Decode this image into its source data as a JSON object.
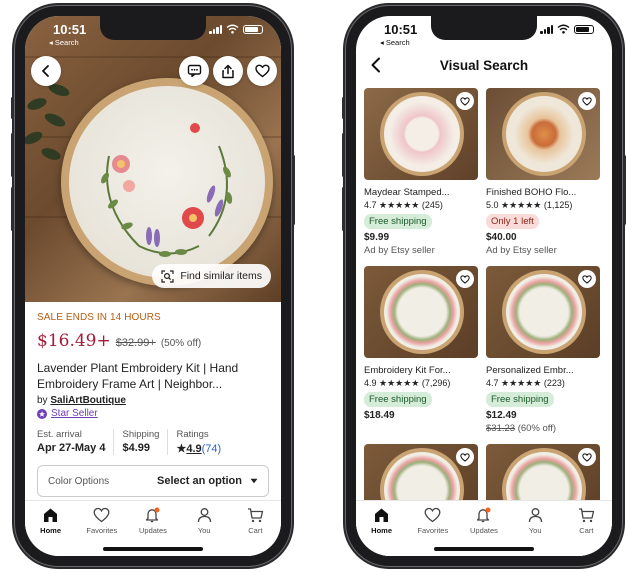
{
  "status": {
    "time": "10:51",
    "back_label": "◂ Search"
  },
  "listing": {
    "similar_label": "Find similar items",
    "sale_banner": "SALE ENDS IN 14 HOURS",
    "price_now": "$16.49+",
    "price_old": "$32.99+",
    "price_off": "(50% off)",
    "title": "Lavender Plant Embroidery Kit | Hand Embroidery Frame Art | Neighbor...",
    "by_prefix": "by",
    "seller": "SaliArtBoutique",
    "star_seller": "Star Seller",
    "specs": [
      {
        "label": "Est. arrival",
        "value": "Apr 27-May 4"
      },
      {
        "label": "Shipping",
        "value": "$4.99"
      },
      {
        "label": "Ratings",
        "value": "4.9",
        "count": "(74)"
      }
    ],
    "option_label": "Color Options",
    "option_value": "Select an option"
  },
  "tabs": [
    {
      "label": "Home"
    },
    {
      "label": "Favorites"
    },
    {
      "label": "Updates"
    },
    {
      "label": "You"
    },
    {
      "label": "Cart"
    }
  ],
  "search": {
    "title": "Visual Search",
    "cards": [
      {
        "title": "Maydear Stamped...",
        "rating": "4.7 ★★★★★ (245)",
        "badge": "Free shipping",
        "badge_type": "green",
        "price": "$9.99",
        "sub": "Ad by Etsy seller"
      },
      {
        "title": "Finished BOHO Flo...",
        "rating": "5.0 ★★★★★ (1,125)",
        "badge": "Only 1 left",
        "badge_type": "pink",
        "price": "$40.00",
        "sub": "Ad by Etsy seller"
      },
      {
        "title": "Embroidery Kit For...",
        "rating": "4.9 ★★★★★ (7,296)",
        "badge": "Free shipping",
        "badge_type": "green",
        "price": "$18.49",
        "sub": ""
      },
      {
        "title": "Personalized Embr...",
        "rating": "4.7 ★★★★★ (223)",
        "badge": "Free shipping",
        "badge_type": "green",
        "price": "$12.49",
        "sub_old": "$31.23",
        "sub": "(60% off)"
      },
      {
        "title": "",
        "rating": "",
        "badge": "",
        "price": "",
        "sub": ""
      },
      {
        "title": "",
        "rating": "",
        "badge": "",
        "price": "",
        "sub": ""
      }
    ]
  },
  "colors": {
    "price_red": "#a61a3a",
    "sale_orange": "#b85c10",
    "star_seller_purple": "#6f3fb8",
    "notification_orange": "#f1641e"
  }
}
